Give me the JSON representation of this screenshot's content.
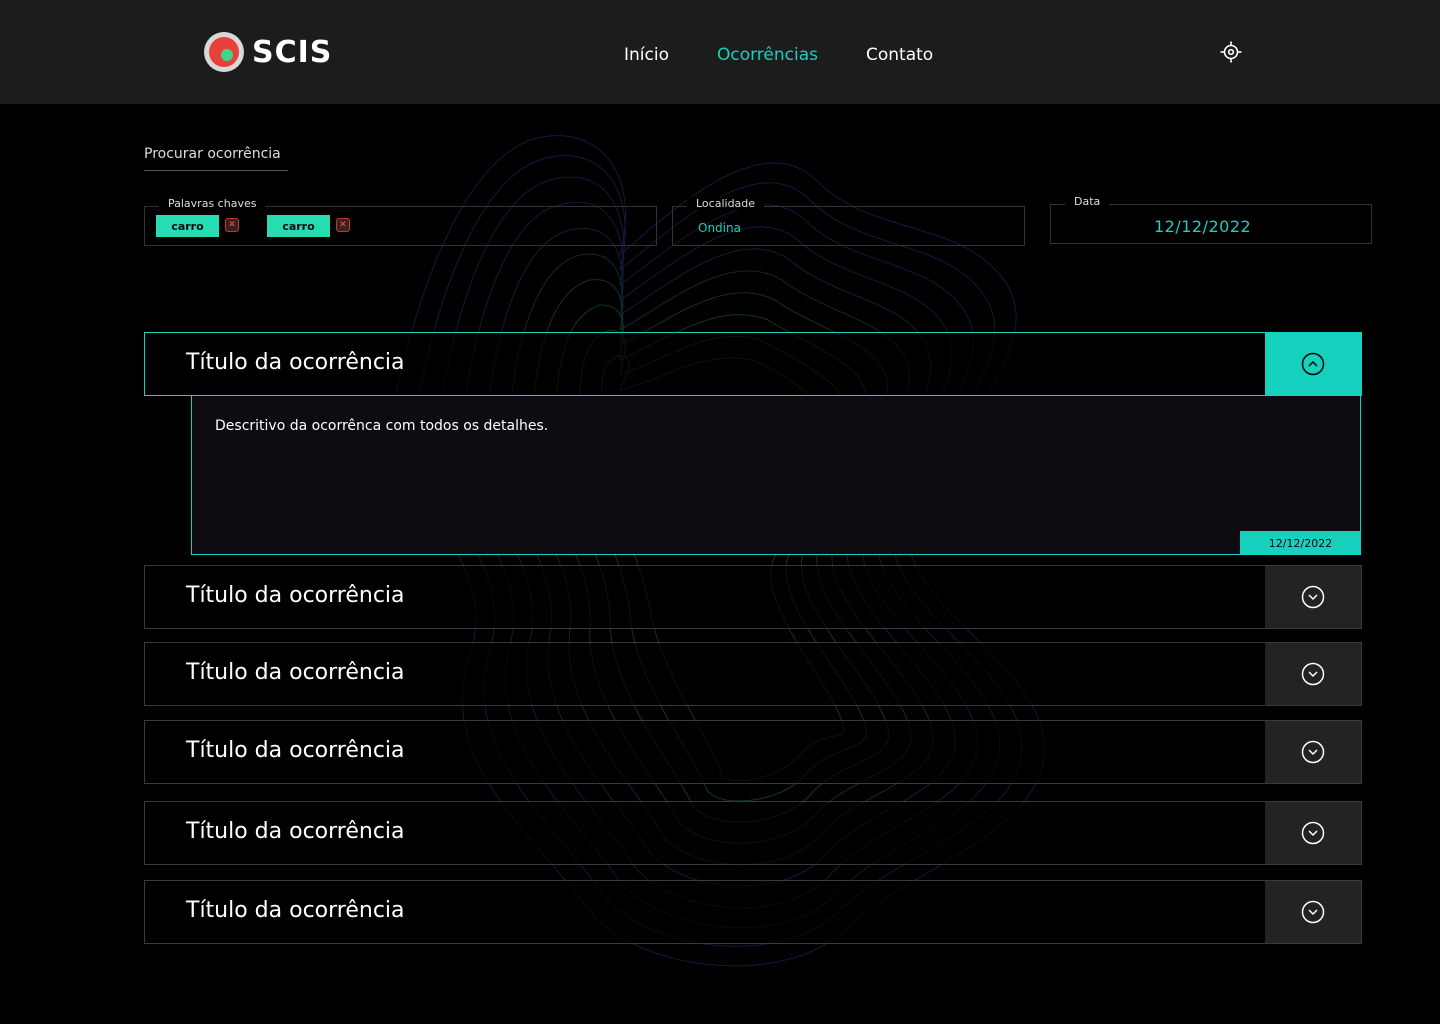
{
  "brand": {
    "name": "SCIS",
    "logo_icon": "scis-logo-icon"
  },
  "nav": {
    "items": [
      "Início",
      "Ocorrências",
      "Contato"
    ],
    "active": "Ocorrências"
  },
  "header_icon": "location-target-icon",
  "search": {
    "tab_label": "Procurar ocorrência",
    "keywords": {
      "label": "Palavras chaves",
      "chips": [
        "carro",
        "carro"
      ]
    },
    "locality": {
      "label": "Localidade",
      "value": "Ondina"
    },
    "date": {
      "label": "Data",
      "value": "12/12/2022"
    }
  },
  "occurrences": [
    {
      "title": "Título da ocorrência",
      "expanded": true,
      "description": "Descritivo da ocorrênca com todos os detalhes.",
      "date": "12/12/2022"
    },
    {
      "title": "Título da ocorrência",
      "expanded": false
    },
    {
      "title": "Título da ocorrência",
      "expanded": false
    },
    {
      "title": "Título da ocorrência",
      "expanded": false
    },
    {
      "title": "Título da ocorrência",
      "expanded": false
    },
    {
      "title": "Título da ocorrência",
      "expanded": false
    }
  ],
  "colors": {
    "accent": "#16d1bd",
    "chip": "#27dcb3",
    "header_bg": "#1c1c1c",
    "background": "#000000"
  }
}
